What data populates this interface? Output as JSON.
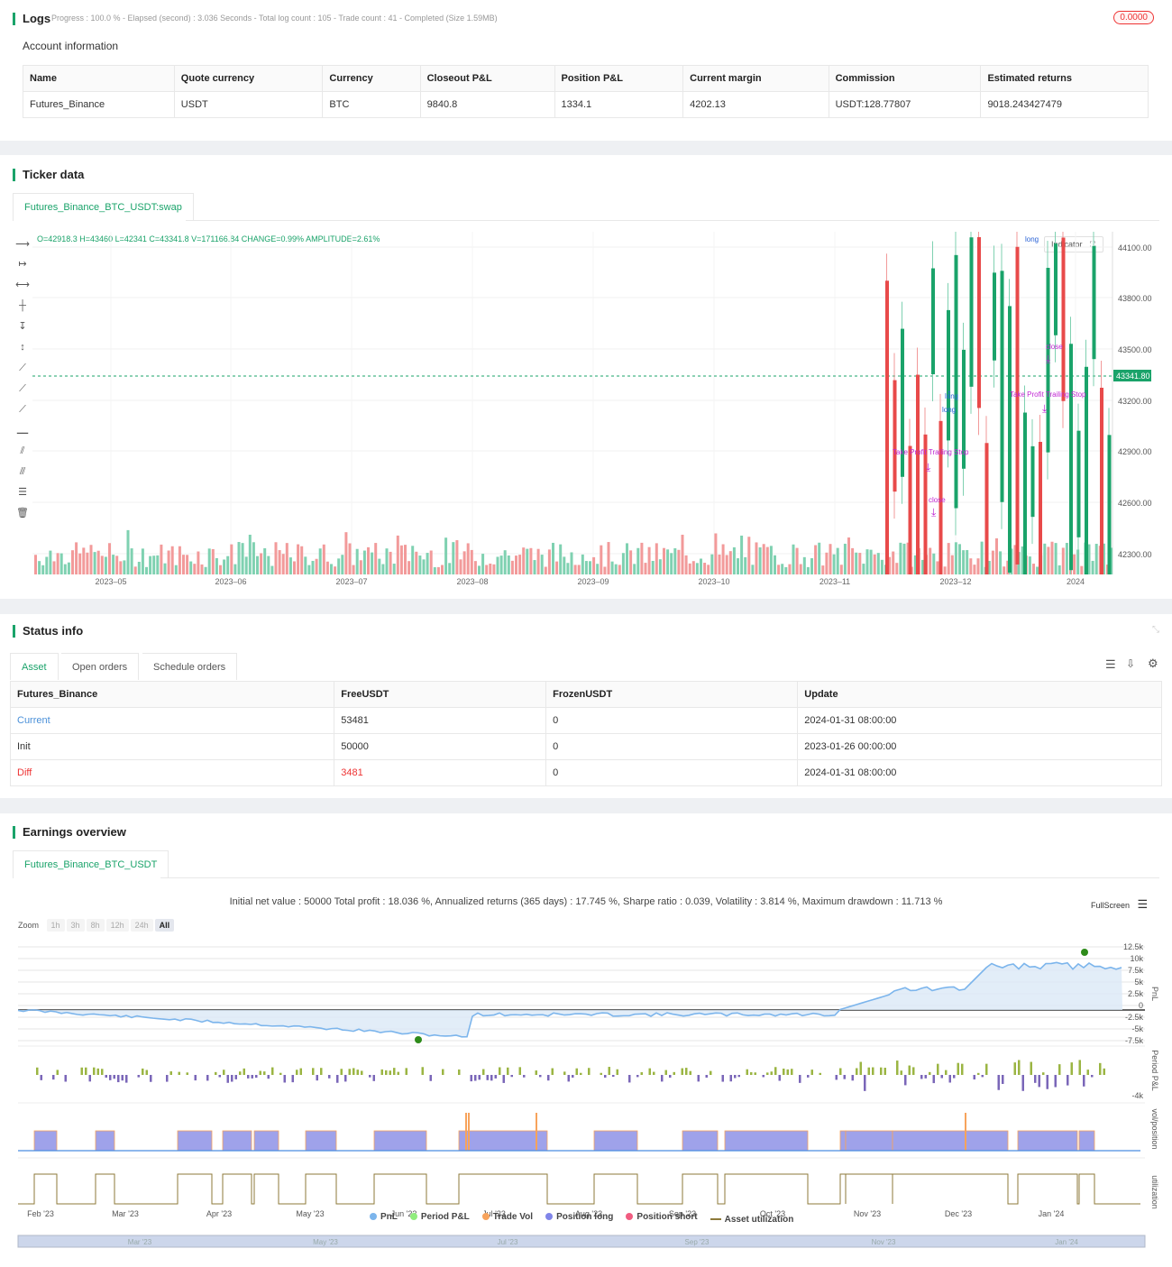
{
  "logs": {
    "title": "Logs",
    "status": "Progress : 100.0 % - Elapsed (second) : 3.036  Seconds - Total log count : 105 - Trade count : 41 - Completed (Size 1.59MB)",
    "badge": "0.0000",
    "account_title": "Account information",
    "columns": [
      "Name",
      "Quote currency",
      "Currency",
      "Closeout P&L",
      "Position P&L",
      "Current margin",
      "Commission",
      "Estimated returns"
    ],
    "row": [
      "Futures_Binance",
      "USDT",
      "BTC",
      "9840.8",
      "1334.1",
      "4202.13",
      "USDT:128.77807",
      "9018.243427479"
    ]
  },
  "ticker": {
    "title": "Ticker data",
    "tab": "Futures_Binance_BTC_USDT:swap",
    "ohlc": "O=42918.3 H=43460 L=42341 C=43341.8 V=171166.84 CHANGE=0.99% AMPLITUDE=2.61%",
    "indicator_label": "Indicator",
    "current_price": "43341.80",
    "price_ticks": [
      "44100.00",
      "43800.00",
      "43500.00",
      "43200.00",
      "42900.00",
      "42600.00",
      "42300.00"
    ],
    "date_ticks": [
      "2023–05",
      "2023–06",
      "2023–07",
      "2023–08",
      "2023–09",
      "2023–10",
      "2023–11",
      "2023–12",
      "2024"
    ],
    "annotations": [
      "long",
      "long",
      "close",
      "close",
      "Take Profit Trailing Stop",
      "Take Profit Trailing Stop",
      "long"
    ]
  },
  "status": {
    "title": "Status info",
    "tabs": [
      "Asset",
      "Open orders",
      "Schedule orders"
    ],
    "columns": [
      "Futures_Binance",
      "FreeUSDT",
      "FrozenUSDT",
      "Update"
    ],
    "rows": [
      [
        "Current",
        "53481",
        "0",
        "2024-01-31 08:00:00"
      ],
      [
        "Init",
        "50000",
        "0",
        "2023-01-26 00:00:00"
      ],
      [
        "Diff",
        "3481",
        "0",
        "2024-01-31 08:00:00"
      ]
    ]
  },
  "earnings": {
    "title": "Earnings overview",
    "tab": "Futures_Binance_BTC_USDT",
    "summary": "Initial net value : 50000 Total profit : 18.036 %, Annualized returns (365 days) : 17.745 %, Sharpe ratio : 0.039, Volatility : 3.814 %, Maximum drawdown : 11.713 %",
    "fullscreen": "FullScreen",
    "zoom_label": "Zoom",
    "zoom_buttons": [
      "1h",
      "3h",
      "8h",
      "12h",
      "24h",
      "All"
    ],
    "pnl_ticks": [
      "12.5k",
      "10k",
      "7.5k",
      "5k",
      "2.5k",
      "0",
      "-2.5k",
      "-5k",
      "-7.5k"
    ],
    "period_tick": "-4k",
    "axis_titles": [
      "PnL",
      "Period P&L",
      "vol/position",
      "utilization"
    ],
    "x_ticks": [
      "Feb '23",
      "Mar '23",
      "Apr '23",
      "May '23",
      "Jun '23",
      "Jul '23",
      "Aug '23",
      "Sep '23",
      "Oct '23",
      "Nov '23",
      "Dec '23",
      "Jan '24"
    ],
    "nav_ticks": [
      "Mar '23",
      "May '23",
      "Jul '23",
      "Sep '23",
      "Nov '23",
      "Jan '24"
    ],
    "legend": [
      {
        "label": "PnL",
        "color": "#7cb5ec"
      },
      {
        "label": "Period P&L",
        "color": "#90ed7d"
      },
      {
        "label": "Trade Vol",
        "color": "#f7a35c"
      },
      {
        "label": "Position long",
        "color": "#8085e9"
      },
      {
        "label": "Position short",
        "color": "#f15c80"
      },
      {
        "label": "Asset utilization",
        "color": "#8d7a3a"
      }
    ]
  }
}
